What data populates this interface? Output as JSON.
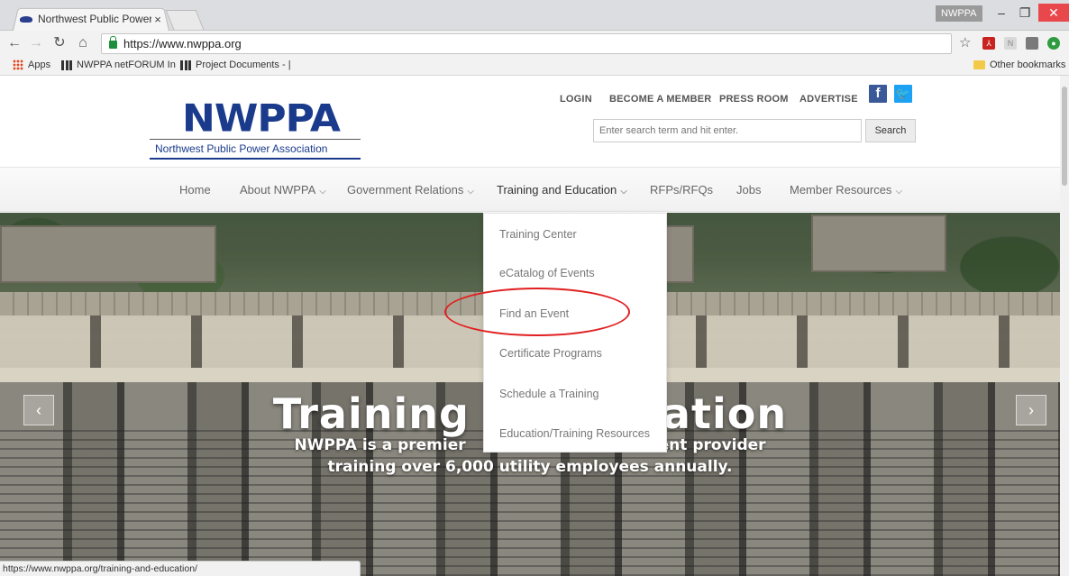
{
  "browser": {
    "tab_title": "Northwest Public Power",
    "tab_close": "×",
    "url": "https://www.nwppa.org",
    "profile": "NWPPA",
    "status_url": "https://www.nwppa.org/training-and-education/",
    "bookmarks": {
      "apps": "Apps",
      "netforum": "NWPPA netFORUM In",
      "project": "Project Documents - |",
      "other": "Other bookmarks"
    }
  },
  "site": {
    "logo": "NWPPA",
    "logo_sub": "Northwest Public Power Association",
    "top_links": [
      "LOGIN",
      "BECOME A MEMBER",
      "PRESS ROOM",
      "ADVERTISE"
    ],
    "search_placeholder": "Enter search term and hit enter.",
    "search_button": "Search",
    "menu": [
      "Home",
      "About NWPPA",
      "Government Relations",
      "Training and Education",
      "RFPs/RFQs",
      "Jobs",
      "Member Resources"
    ],
    "dropdown": [
      "Training Center",
      "eCatalog of Events",
      "Find an Event",
      "Certificate Programs",
      "Schedule a Training",
      "Education/Training Resources"
    ],
    "hero": {
      "title_left": "Training",
      "title_right": "ation",
      "sub_line1_a": "NWPPA is a premier",
      "sub_line1_b": "ent provider",
      "sub_line2": "training over 6,000 utility employees annually."
    }
  },
  "colors": {
    "brand_blue": "#1a3a8c",
    "facebook": "#3b5998",
    "twitter": "#1da1f2",
    "annotation_red": "#e02020"
  }
}
